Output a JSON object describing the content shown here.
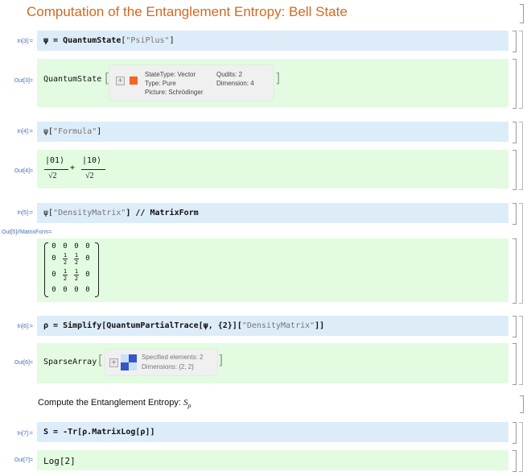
{
  "title": "Computation of the Entanglement Entropy: Bell State",
  "cells": {
    "in3": {
      "label": "In[3]:=",
      "var": "ψ",
      "eq": " = ",
      "fn": "QuantumState",
      "open": "[",
      "arg": "\"PsiPlus\"",
      "close": "]"
    },
    "out3": {
      "label": "Out[3]=",
      "head": "QuantumState",
      "summary": {
        "state_type": "StateType: Vector",
        "type": "Type: Pure",
        "picture": "Picture: Schrödinger",
        "qudits": "Qudits: 2",
        "dimension": "Dimension: 4",
        "color": "#f26522"
      }
    },
    "in4": {
      "label": "In[4]:=",
      "code_pre": "ψ[",
      "code_str": "\"Formula\"",
      "code_post": "]"
    },
    "out4": {
      "label": "Out[4]=",
      "ket1": "|01⟩",
      "ket2": "|10⟩",
      "den1": "√2",
      "den2": "√2",
      "plus": "+"
    },
    "in5": {
      "label": "In[5]:=",
      "code_pre": "ψ[",
      "code_str": "\"DensityMatrix\"",
      "code_post": "] // MatrixForm"
    },
    "out5": {
      "label": "Out[5]//MatrixForm=",
      "matrix": [
        [
          "0",
          "0",
          "0",
          "0"
        ],
        [
          "0",
          "1/2",
          "1/2",
          "0"
        ],
        [
          "0",
          "1/2",
          "1/2",
          "0"
        ],
        [
          "0",
          "0",
          "0",
          "0"
        ]
      ]
    },
    "in6": {
      "label": "In[6]:=",
      "code_pre": "ρ = Simplify[QuantumPartialTrace[ψ, {2}][",
      "code_str": "\"DensityMatrix\"",
      "code_post": "]]"
    },
    "out6": {
      "label": "Out[6]=",
      "head": "SparseArray",
      "summary": {
        "specified": "Specified elements: 2",
        "dimensions": "Dimensions: {2, 2}"
      }
    },
    "text": {
      "pre": "Compute the Entanglement Entropy: ",
      "sym": "S",
      "sub": "ρ"
    },
    "in7": {
      "label": "In[7]:=",
      "code": "S = -Tr[ρ.MatrixLog[ρ]]"
    },
    "out7": {
      "label": "Out[7]=",
      "value": "Log[2]"
    }
  }
}
